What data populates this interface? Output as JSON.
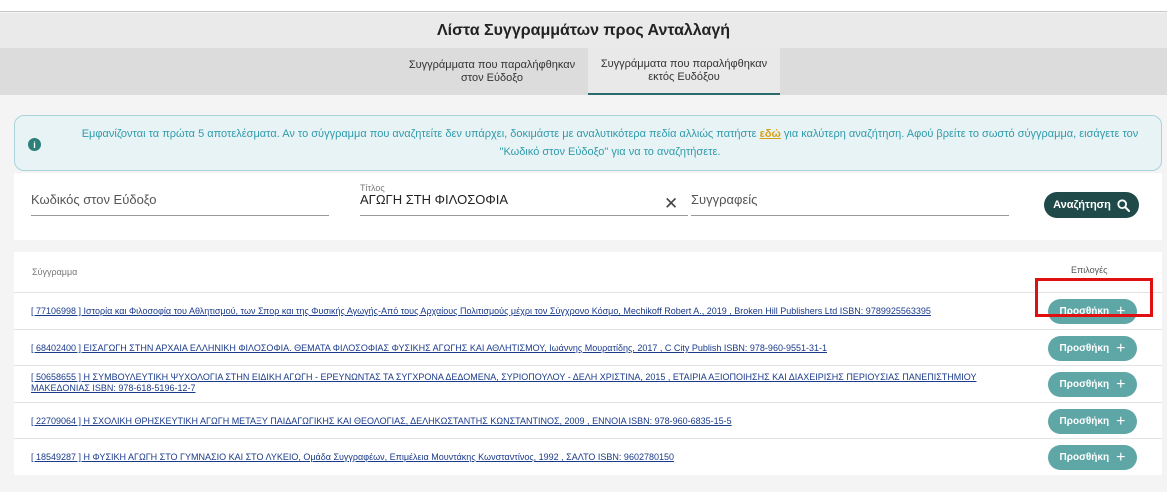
{
  "page": {
    "title": "Λίστα Συγγραμμάτων προς Ανταλλαγή"
  },
  "tabs": [
    {
      "label": "Συγγράμματα που παραλήφθηκαν\nστον Εύδοξο",
      "active": false
    },
    {
      "label": "Συγγράμματα που παραλήφθηκαν\nεκτός Ευδόξου",
      "active": true
    }
  ],
  "info": {
    "icon": "info-icon",
    "text_before": "Εμφανίζονται τα πρώτα 5 αποτελέσματα. Αν το σύγγραμμα που αναζητείτε δεν υπάρχει, δοκιμάστε με αναλυτικότερα πεδία αλλιώς πατήστε ",
    "link": "εδώ",
    "text_after": " για καλύτερη αναζήτηση. Αφού βρείτε το σωστό σύγγραμμα, εισάγετε τον \"Κωδικό στον Εύδοξο\" για να το αναζητήσετε.",
    "colors": {
      "text": "#2f9bab",
      "link": "#d4a017",
      "border": "#a9d3db"
    }
  },
  "search": {
    "code_placeholder": "Κωδικός στον Εύδοξο",
    "title_label": "Τίτλος",
    "title_value": "ΑΓΩΓΗ ΣΤΗ ΦΙΛΟΣΟΦΙΑ",
    "clear_icon": "close-icon",
    "authors_placeholder": "Συγγραφείς",
    "button_label": "Αναζήτηση",
    "button_icon": "search-icon",
    "button_color": "#1f4a49"
  },
  "results": {
    "col_book": "Σύγγραμμα",
    "col_options": "Επιλογές",
    "add_label": "Προσθήκη",
    "add_icon": "plus-icon",
    "add_color": "#5fa6a6",
    "highlight_color": "#e01010",
    "rows": [
      {
        "text": "[ 77106998 ] Ιστορία και Φιλοσοφία του Αθλητισμού, των Σπορ και της Φυσικής Αγωγής-Από τους Αρχαίους Πολιτισμούς μέχρι τον Σύγχρονο Κόσμο, Mechikoff Robert A., 2019 , Broken Hill Publishers Ltd ISBN: 9789925563395"
      },
      {
        "text": "[ 68402400 ] ΕΙΣΑΓΩΓΗ ΣΤΗΝ ΑΡΧΑΙΑ ΕΛΛΗΝΙΚΗ ΦΙΛΟΣΟΦΙΑ. ΘΕΜΑΤΑ ΦΙΛΟΣΟΦΙΑΣ ΦΥΣΙΚΗΣ ΑΓΩΓΗΣ ΚΑΙ ΑΘΛΗΤΙΣΜΟΥ, Ιωάννης Μουρατίδης, 2017 , C City Publish ISBN: 978-960-9551-31-1"
      },
      {
        "text": "[ 50658655 ] Η ΣΥΜΒΟΥΛΕΥΤΙΚΗ ΨΥΧΟΛΟΓΙΑ ΣΤΗΝ ΕΙΔΙΚΗ ΑΓΩΓΗ - ΕΡΕΥΝΩΝΤΑΣ ΤΑ ΣΥΓΧΡΟΝΑ ΔΕΔΟΜΕΝΑ, ΣΥΡΙΟΠΟΥΛΟΥ - ΔΕΛΗ ΧΡΙΣΤΙΝΑ, 2015 , ΕΤΑΙΡΙΑ ΑΞΙΟΠΟΙΗΣΗΣ ΚΑΙ ΔΙΑΧΕΙΡΙΣΗΣ ΠΕΡΙΟΥΣΙΑΣ ΠΑΝΕΠΙΣΤΗΜΙΟΥ ΜΑΚΕΔΟΝΙΑΣ ISBN: 978-618-5196-12-7"
      },
      {
        "text": "[ 22709064 ] Η ΣΧΟΛΙΚΗ ΘΡΗΣΚΕΥΤΙΚΗ ΑΓΩΓΗ ΜΕΤΑΞΥ ΠΑΙΔΑΓΩΓΙΚΗΣ ΚΑΙ ΘΕΟΛΟΓΙΑΣ, ΔΕΛΗΚΩΣΤΑΝΤΗΣ ΚΩΝΣΤΑΝΤΙΝΟΣ, 2009 , ΕΝΝΟΙΑ ISBN: 978-960-6835-15-5"
      },
      {
        "text": "[ 18549287 ] Η ΦΥΣΙΚΗ ΑΓΩΓΗ ΣΤΟ ΓΥΜΝΑΣΙΟ ΚΑΙ ΣΤΟ ΛΥΚΕΙΟ, Ομάδα Συγγραφέων, Επιμέλεια Μουντάκης Κωνσταντίνος, 1992 , ΣΑΛΤΟ ISBN: 9602780150"
      }
    ]
  }
}
